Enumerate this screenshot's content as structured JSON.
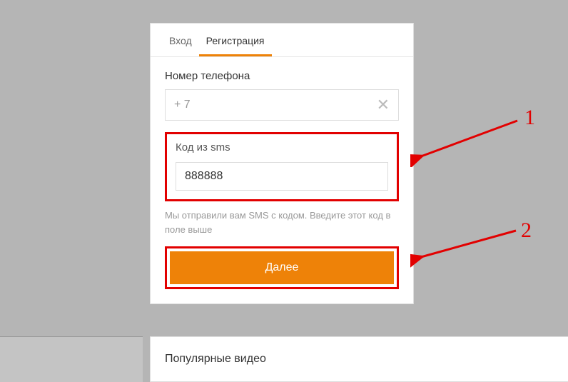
{
  "tabs": {
    "login": "Вход",
    "register": "Регистрация"
  },
  "phone": {
    "label": "Номер телефона",
    "prefix": "+ 7"
  },
  "sms": {
    "label": "Код из sms",
    "value": "888888",
    "note": "Мы отправили вам SMS с кодом. Введите этот код в поле выше"
  },
  "button": {
    "next": "Далее"
  },
  "annotations": {
    "one": "1",
    "two": "2"
  },
  "lower": {
    "title": "Популярные видео"
  }
}
